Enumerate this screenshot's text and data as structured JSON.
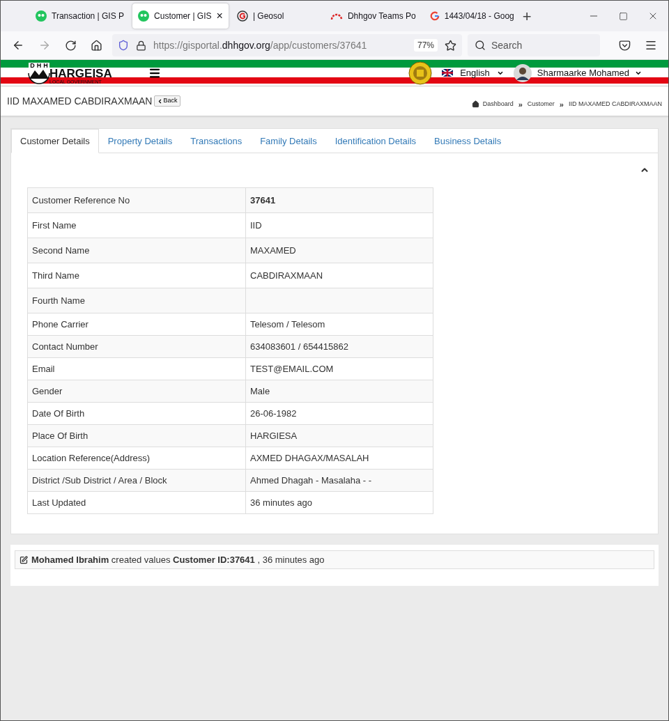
{
  "browser": {
    "tabs": [
      {
        "title": "Transaction | GIS P",
        "kind": "green",
        "selected": false
      },
      {
        "title": "Customer | GIS",
        "kind": "green",
        "selected": true,
        "close": "×"
      },
      {
        "title": "| Geosol",
        "kind": "geosol",
        "selected": false
      },
      {
        "title": "Dhhgov Teams Po",
        "kind": "arc",
        "selected": false
      },
      {
        "title": "1443/04/18 - Goog",
        "kind": "google",
        "selected": false
      }
    ],
    "new_tab": "+",
    "url_prefix": "https://gisportal.",
    "url_domain": "dhhgov.org",
    "url_path": "/app/customers/37641",
    "zoom": "77%",
    "search_placeholder": "Search"
  },
  "header": {
    "logo_letters": [
      "D",
      "H",
      "H"
    ],
    "logo_title": "HARGEISA",
    "logo_subtitle": "LOCAL GOVERNMENT",
    "language": "English",
    "user": "Sharmaarke Mohamed"
  },
  "page": {
    "title": "IID MAXAMED CABDIRAXMAAN",
    "back": "Back",
    "breadcrumb_separator": "»",
    "breadcrumb": [
      "Dashboard",
      "Customer",
      "IID MAXAMED CABDIRAXMAAN"
    ]
  },
  "tabs": [
    {
      "label": "Customer Details",
      "selected": true
    },
    {
      "label": "Property Details",
      "selected": false
    },
    {
      "label": "Transactions",
      "selected": false
    },
    {
      "label": "Family Details",
      "selected": false
    },
    {
      "label": "Identification Details",
      "selected": false
    },
    {
      "label": "Business Details",
      "selected": false
    }
  ],
  "details": [
    {
      "label": "Customer Reference No",
      "value": "37641",
      "bold": true
    },
    {
      "label": "First Name",
      "value": "IID"
    },
    {
      "label": "Second Name",
      "value": "MAXAMED"
    },
    {
      "label": "Third Name",
      "value": "CABDIRAXMAAN"
    },
    {
      "label": "Fourth Name"
    },
    {
      "label": "Phone Carrier",
      "value": "Telesom / Telesom"
    },
    {
      "label": "Contact Number",
      "value": "634083601 / 654415862"
    },
    {
      "label": "Email",
      "value": "TEST@EMAIL.COM"
    },
    {
      "label": "Gender",
      "value": "Male"
    },
    {
      "label": "Date Of Birth",
      "value": "26-06-1982"
    },
    {
      "label": "Place Of Birth",
      "value": "HARGIESA"
    },
    {
      "label": "Location Reference(Address)",
      "value": "AXMED DHAGAX/MASALAH"
    },
    {
      "label": "District /Sub District / Area / Block",
      "value": "Ahmed Dhagah - Masalaha - -"
    },
    {
      "label": "Last Updated",
      "value": "36 minutes ago"
    }
  ],
  "activity": "**Mohamed Ibrahim** created values **Customer ID:37641** , 36 minutes ago"
}
